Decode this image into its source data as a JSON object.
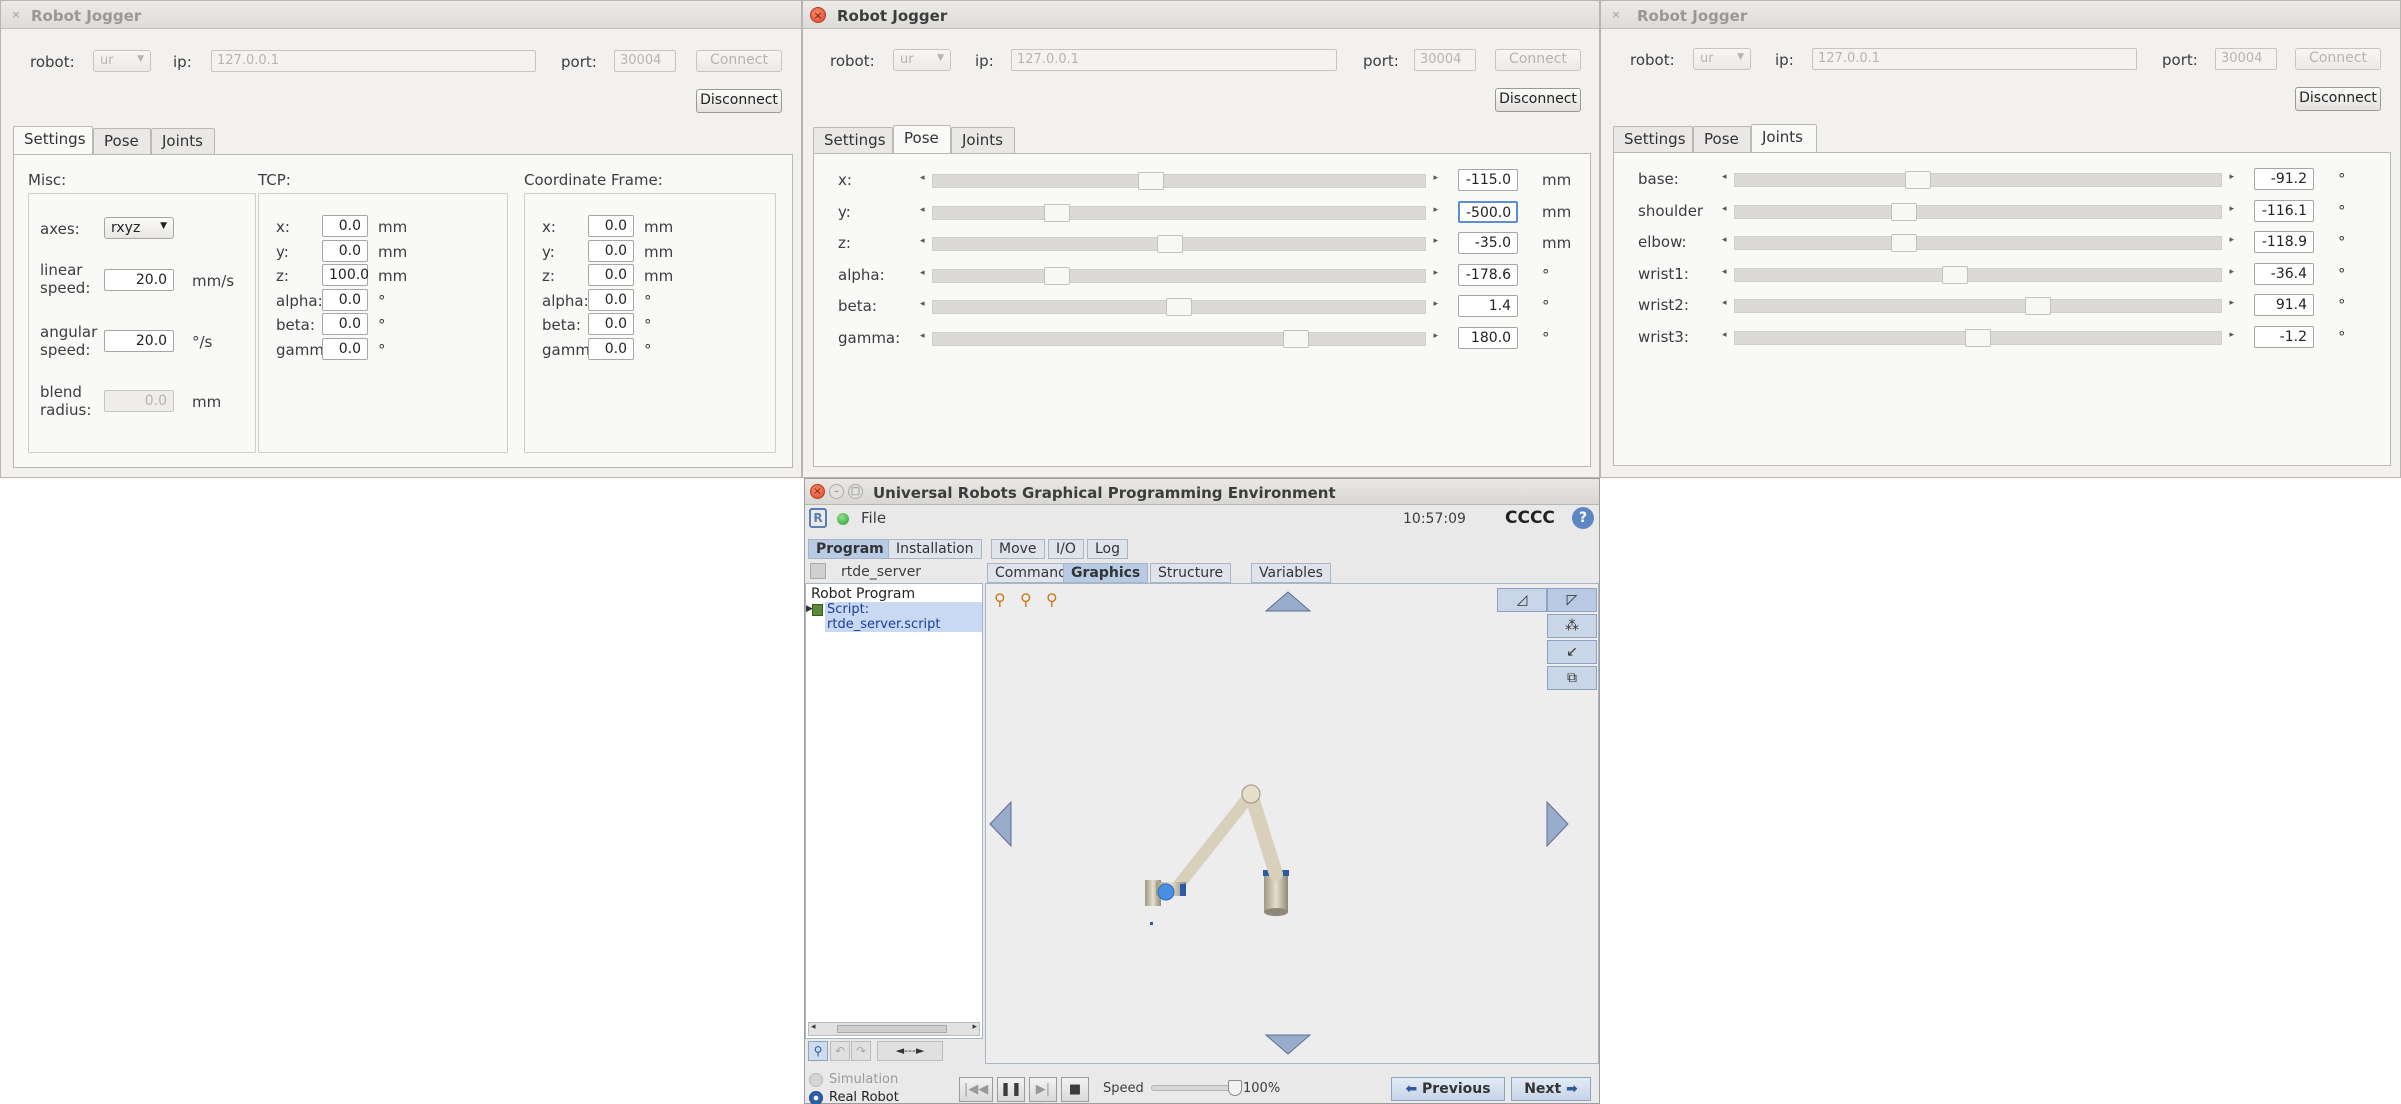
{
  "jogger": {
    "window_title": "Robot Jogger",
    "close_glyph": "×",
    "robot_label": "robot:",
    "robot_value": "ur",
    "ip_label": "ip:",
    "ip_value": "127.0.0.1",
    "port_label": "port:",
    "port_value": "30004",
    "connect_label": "Connect",
    "disconnect_label": "Disconnect",
    "tabs": [
      "Settings",
      "Pose",
      "Joints"
    ]
  },
  "settings": {
    "misc_title": "Misc:",
    "axes_label": "axes:",
    "axes_value": "rxyz",
    "linear_label_1": "linear",
    "linear_label_2": "speed:",
    "linear_value": "20.0",
    "linear_unit": "mm/s",
    "angular_label_1": "angular",
    "angular_label_2": "speed:",
    "angular_value": "20.0",
    "angular_unit": "°/s",
    "blend_label_1": "blend",
    "blend_label_2": "radius:",
    "blend_value": "0.0",
    "blend_unit": "mm",
    "tcp_title": "TCP:",
    "tcp": [
      {
        "label": "x:",
        "value": "0.0",
        "unit": "mm"
      },
      {
        "label": "y:",
        "value": "0.0",
        "unit": "mm"
      },
      {
        "label": "z:",
        "value": "100.0",
        "unit": "mm"
      },
      {
        "label": "alpha:",
        "value": "0.0",
        "unit": "°"
      },
      {
        "label": "beta:",
        "value": "0.0",
        "unit": "°"
      },
      {
        "label": "gamma",
        "value": "0.0",
        "unit": "°"
      }
    ],
    "frame_title": "Coordinate Frame:",
    "frame": [
      {
        "label": "x:",
        "value": "0.0",
        "unit": "mm"
      },
      {
        "label": "y:",
        "value": "0.0",
        "unit": "mm"
      },
      {
        "label": "z:",
        "value": "0.0",
        "unit": "mm"
      },
      {
        "label": "alpha:",
        "value": "0.0",
        "unit": "°"
      },
      {
        "label": "beta:",
        "value": "0.0",
        "unit": "°"
      },
      {
        "label": "gamma",
        "value": "0.0",
        "unit": "°"
      }
    ]
  },
  "pose": {
    "rows": [
      {
        "label": "x:",
        "value": "-115.0",
        "unit": "mm",
        "slider_fraction": 0.44
      },
      {
        "label": "y:",
        "value": "-500.0",
        "unit": "mm",
        "slider_fraction": 0.24
      },
      {
        "label": "z:",
        "value": "-35.0",
        "unit": "mm",
        "slider_fraction": 0.48
      },
      {
        "label": "alpha:",
        "value": "-178.6",
        "unit": "°",
        "slider_fraction": 0.24
      },
      {
        "label": "beta:",
        "value": "1.4",
        "unit": "°",
        "slider_fraction": 0.5
      },
      {
        "label": "gamma:",
        "value": "180.0",
        "unit": "°",
        "slider_fraction": 0.75
      }
    ]
  },
  "joints": {
    "rows": [
      {
        "label": "base:",
        "value": "-91.2",
        "unit": "°",
        "slider_fraction": 0.37
      },
      {
        "label": "shoulder",
        "value": "-116.1",
        "unit": "°",
        "slider_fraction": 0.34
      },
      {
        "label": "elbow:",
        "value": "-118.9",
        "unit": "°",
        "slider_fraction": 0.34
      },
      {
        "label": "wrist1:",
        "value": "-36.4",
        "unit": "°",
        "slider_fraction": 0.45
      },
      {
        "label": "wrist2:",
        "value": "91.4",
        "unit": "°",
        "slider_fraction": 0.63
      },
      {
        "label": "wrist3:",
        "value": "-1.2",
        "unit": "°",
        "slider_fraction": 0.5
      }
    ]
  },
  "ur": {
    "window_title": "Universal Robots Graphical Programming Environment",
    "file_menu": "File",
    "time": "10:57:09",
    "robot_name": "CCCC",
    "help_glyph": "?",
    "main_tabs": [
      "Program",
      "Installation",
      "Move",
      "I/O",
      "Log"
    ],
    "program_name": "rtde_server",
    "sub_tabs": [
      "Command",
      "Graphics",
      "Structure",
      "Variables"
    ],
    "tree_root": "Robot Program",
    "tree_item": "Script: rtde_server.script",
    "simulation_label": "Simulation",
    "real_robot_label": "Real Robot",
    "speed_label": "Speed",
    "speed_value": "100%",
    "speed_fraction": 1.0,
    "previous_label": "Previous",
    "next_label": "Next",
    "undo_redo_arrow": "◄---►"
  }
}
